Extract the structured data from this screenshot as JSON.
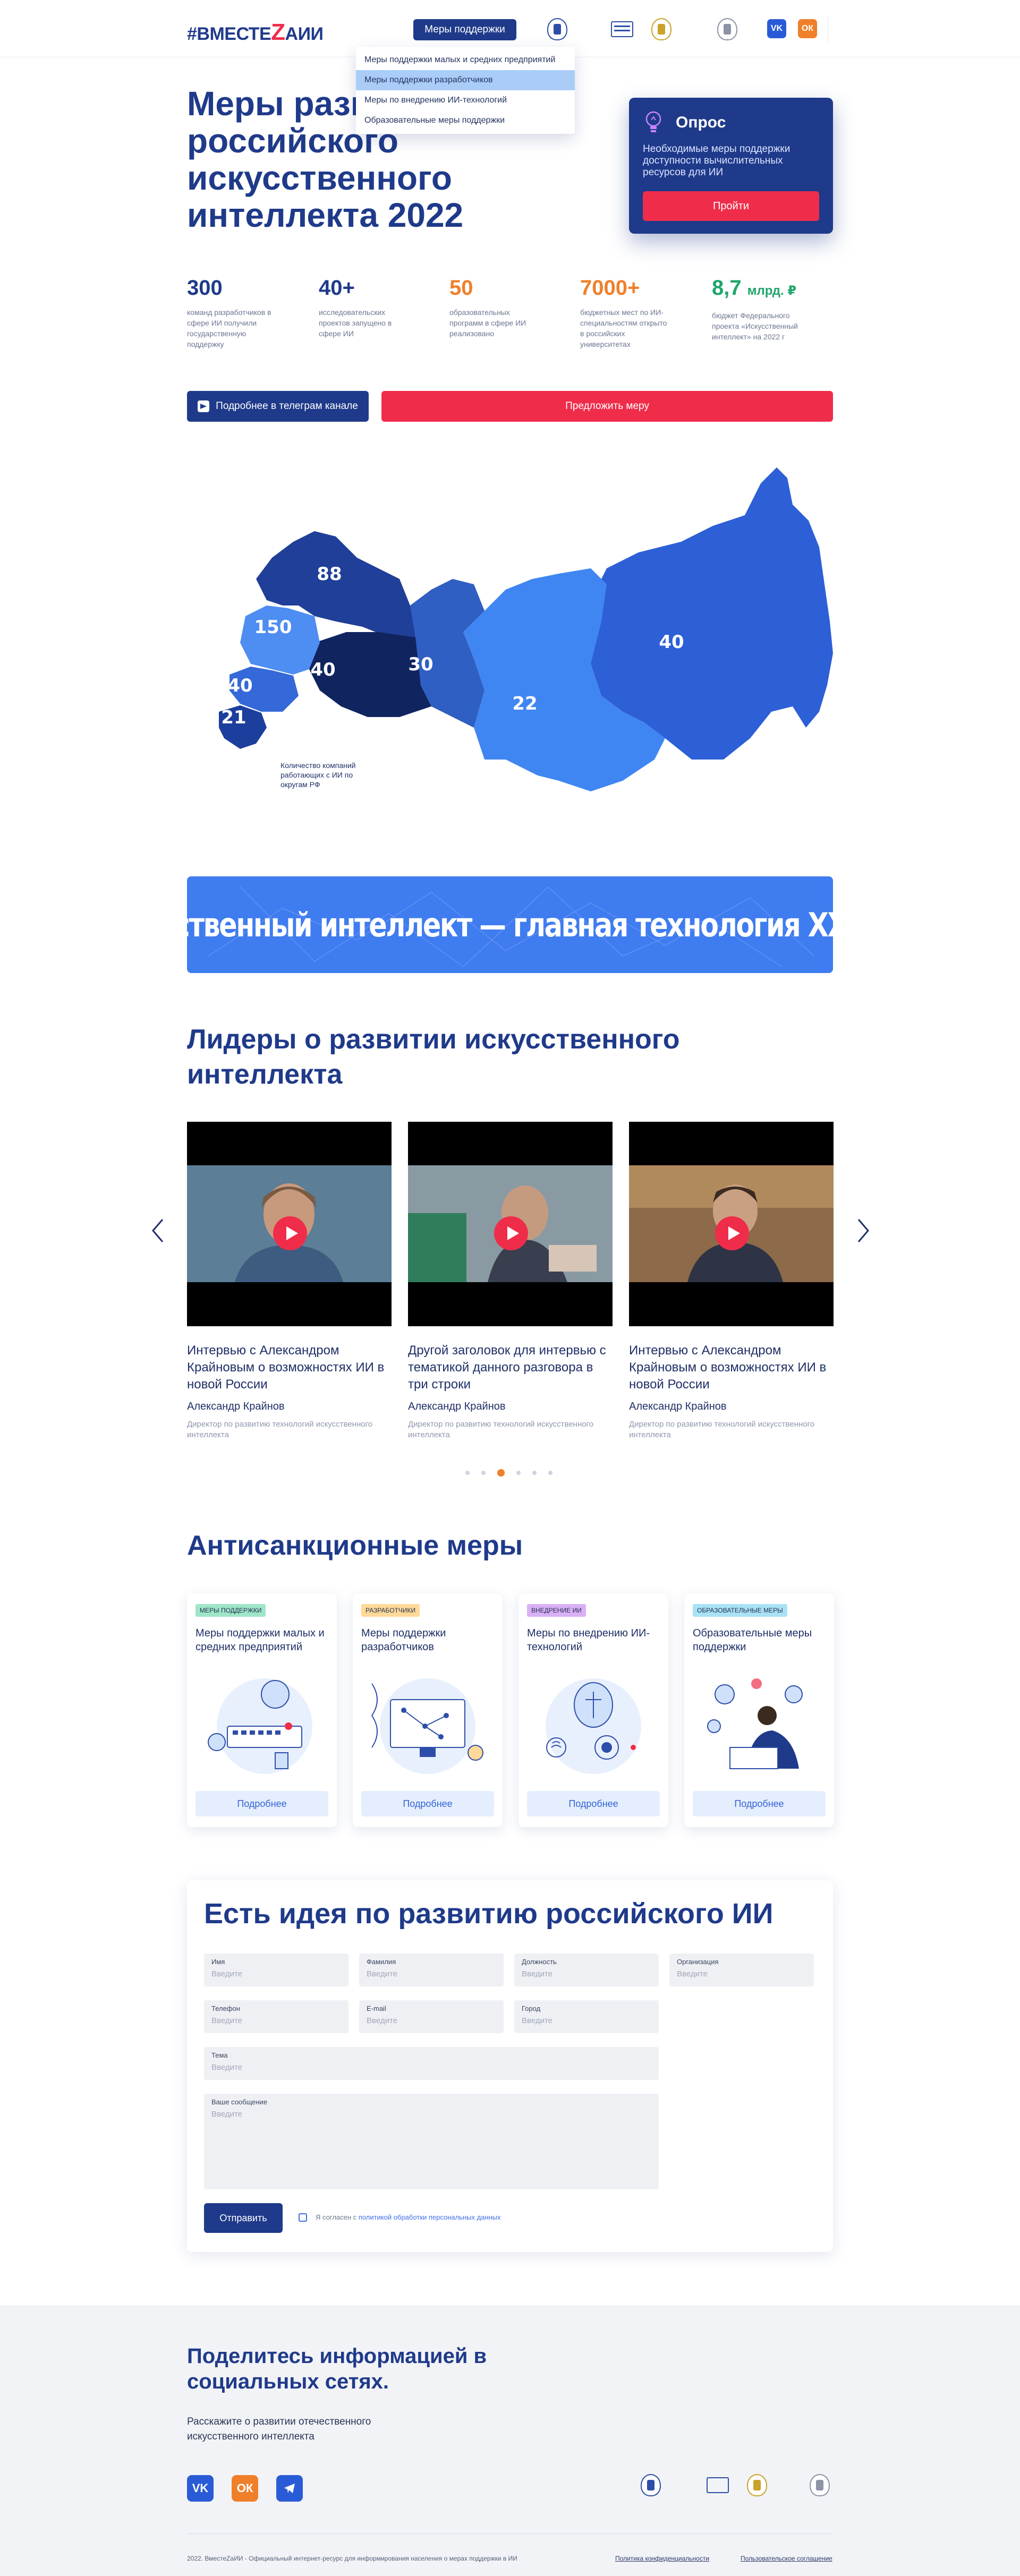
{
  "header": {
    "logo_left": "#ВМЕСТЕ",
    "logo_z": "Z",
    "logo_right": "АИИ",
    "measures_button": "Меры поддержки",
    "vk_label": "VK",
    "ok_label": "ОК"
  },
  "dropdown": {
    "items": [
      {
        "label": "Меры поддержки малых и средних предприятий"
      },
      {
        "label": "Меры поддержки разработчиков"
      },
      {
        "label": "Меры по внедрению ИИ-технологий"
      },
      {
        "label": "Образовательные меры поддержки"
      }
    ],
    "active_index": 1
  },
  "hero": {
    "title": "Меры развития российского искусственного интеллекта 2022"
  },
  "survey": {
    "title": "Опрос",
    "text": "Необходимые меры поддержки доступности вычислительных ресурсов для ИИ",
    "button": "Пройти"
  },
  "stats": [
    {
      "value": "300",
      "unit": "",
      "color": "#1f3a8a",
      "text": "команд разработчиков в сфере ИИ получили государственную поддержку"
    },
    {
      "value": "40+",
      "unit": "",
      "color": "#1f3a8a",
      "text": "исследовательских проектов запущено в сфере ИИ"
    },
    {
      "value": "50",
      "unit": "",
      "color": "#f07f2a",
      "text": "образовательных программ в сфере ИИ реализовано"
    },
    {
      "value": "7000+",
      "unit": "",
      "color": "#f07f2a",
      "text": "бюджетных мест по ИИ-специальностям открыто в российских университетах"
    },
    {
      "value": "8,7",
      "unit": "млрд. ₽",
      "color": "#1fa66a",
      "text": "бюджет Федерального проекта «Искусственный интеллект» на 2022 г"
    }
  ],
  "actions": {
    "telegram_button": "Подробнее в телеграм канале",
    "propose_button": "Предложить меру"
  },
  "map": {
    "label": "Количество компаний работающих с ИИ по округам РФ",
    "district_values": [
      88,
      150,
      40,
      40,
      21,
      30,
      22,
      40
    ]
  },
  "banner": {
    "text": "Искусственный интеллект — главная технология XXI века"
  },
  "leaders": {
    "title": "Лидеры о развитии искусственного интеллекта",
    "videos": [
      {
        "title": "Интервью с Александром Крайновым о возможностях ИИ в новой России",
        "author": "Александр Крайнов",
        "role": "Директор по развитию технологий искусственного интеллекта"
      },
      {
        "title": "Другой заголовок для интервью с тематикой данного разговора в три строки",
        "author": "Александр Крайнов",
        "role": "Директор по развитию технологий искусственного интеллекта"
      },
      {
        "title": "Интервью с Александром Крайновым о возможностях ИИ в новой России",
        "author": "Александр Крайнов",
        "role": "Директор по развитию технологий искусственного интеллекта"
      }
    ],
    "dot_count": 6,
    "active_dot": 2
  },
  "measures": {
    "title": "Антисанкционные меры",
    "cards": [
      {
        "tag": "МЕРЫ ПОДДЕРЖКИ",
        "tag_color": "#9fe6c9",
        "title": "Меры поддержки малых и средних предприятий",
        "button": "Подробнее"
      },
      {
        "tag": "РАЗРАБОТЧИКИ",
        "tag_color": "#ffd999",
        "title": "Меры поддержки разработчиков",
        "button": "Подробнее"
      },
      {
        "tag": "ВНЕДРЕНИЕ ИИ",
        "tag_color": "#d9b0f5",
        "title": "Меры по внедрению ИИ-технологий",
        "button": "Подробнее"
      },
      {
        "tag": "ОБРАЗОВАТЕЛЬНЫЕ МЕРЫ",
        "tag_color": "#a9e2f5",
        "title": "Образовательные меры поддержки",
        "button": "Подробнее"
      }
    ]
  },
  "form": {
    "title": "Есть идея по развитию российского ИИ",
    "fields": {
      "name": {
        "label": "Имя",
        "placeholder": "Введите"
      },
      "surname": {
        "label": "Фамилия",
        "placeholder": "Введите"
      },
      "position": {
        "label": "Должность",
        "placeholder": "Введите"
      },
      "organization": {
        "label": "Организация",
        "placeholder": "Введите"
      },
      "phone": {
        "label": "Телефон",
        "placeholder": "Введите"
      },
      "email": {
        "label": "E-mail",
        "placeholder": "Введите"
      },
      "city": {
        "label": "Город",
        "placeholder": "Введите"
      },
      "topic": {
        "label": "Тема",
        "placeholder": "Введите"
      },
      "message": {
        "label": "Ваше сообщение",
        "placeholder": "Введите"
      }
    },
    "submit": "Отправить",
    "agree_text": "Я согласен с",
    "agree_link": "политикой обработки персональных данных"
  },
  "footer": {
    "share_title": "Поделитесь информацией в социальных сетях.",
    "share_text": "Расскажите о развитии отечественного искусственного интеллекта",
    "copyright": "2022. ВместеZаИИ - Официальный интернет-ресурс для информирования населения о мерах поддержки в ИИ",
    "privacy": "Политика конфиденциальности",
    "terms": "Пользовательское соглашение",
    "vk_label": "VK",
    "ok_label": "ОК"
  }
}
